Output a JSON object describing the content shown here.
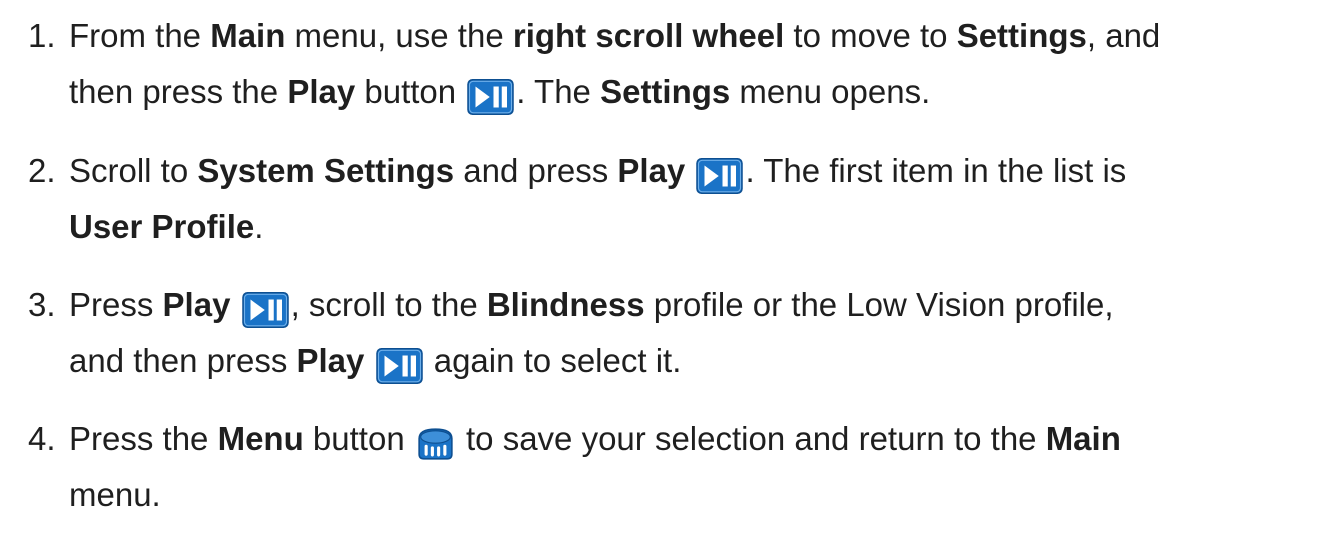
{
  "icons": {
    "play": "play-pause-icon",
    "menu": "menu-button-icon"
  },
  "colors": {
    "play_fill": "#1a73c7",
    "play_border": "#0d4f91",
    "menu_fill": "#1a73c7"
  },
  "steps": [
    {
      "number": "1.",
      "l1_a": "From the ",
      "l1_b": "Main",
      "l1_c": " menu, use the ",
      "l1_d": "right scroll wheel",
      "l1_e": " to move to ",
      "l1_f": "Settings",
      "l1_g": ", and",
      "l2_a": "then press the ",
      "l2_b": "Play",
      "l2_c": " button ",
      "l2_d": ". The ",
      "l2_e": "Settings",
      "l2_f": " menu opens."
    },
    {
      "number": "2.",
      "l1_a": "Scroll to ",
      "l1_b": "System Settings",
      "l1_c": " and press ",
      "l1_d": "Play",
      "l1_e": " ",
      "l1_f": ". The first item in the list is",
      "l2_a": "User Profile",
      "l2_b": "."
    },
    {
      "number": "3.",
      "l1_a": "Press ",
      "l1_b": "Play",
      "l1_c": " ",
      "l1_d": ", scroll to the ",
      "l1_e": "Blindness",
      "l1_f": " profile or the Low Vision profile,",
      "l2_a": "and then press ",
      "l2_b": "Play",
      "l2_c": " ",
      "l2_d": " again to select it."
    },
    {
      "number": "4.",
      "l1_a": "Press the ",
      "l1_b": "Menu",
      "l1_c": " button ",
      "l1_d": " to save your selection and return to the ",
      "l1_e": "Main",
      "l2_a": "menu."
    }
  ]
}
